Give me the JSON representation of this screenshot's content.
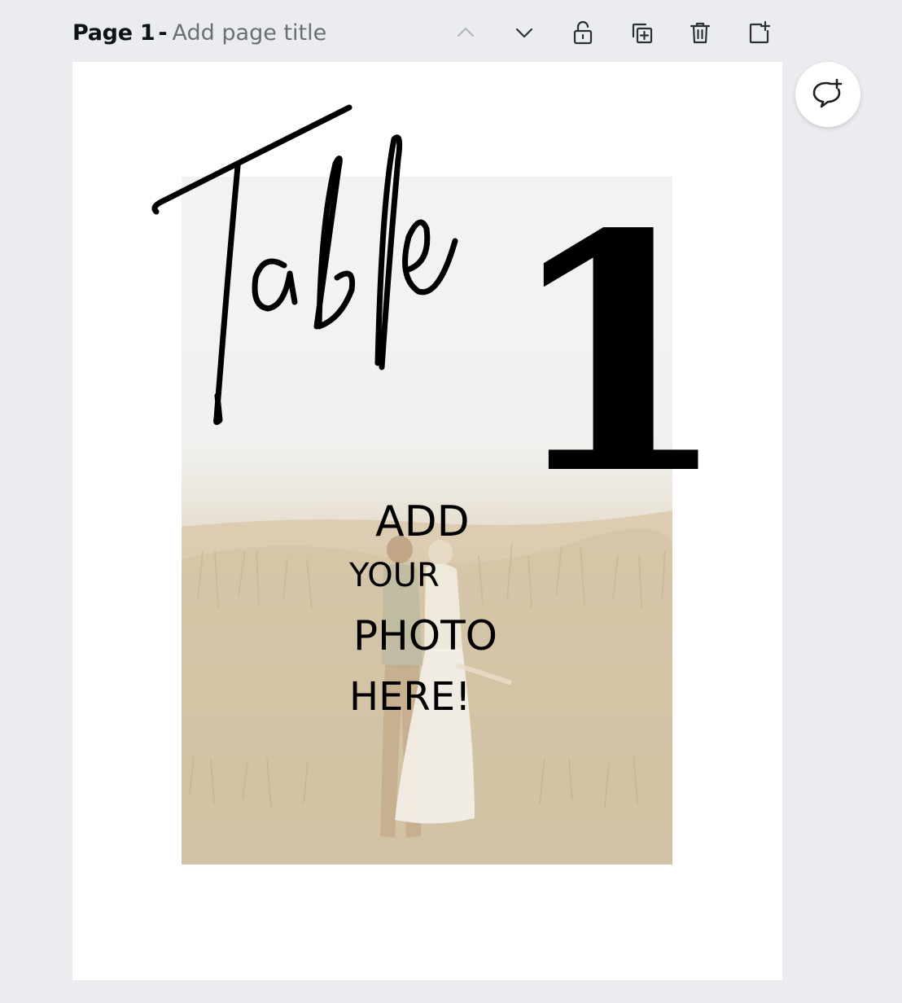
{
  "header": {
    "page_label": "Page 1",
    "separator": "-",
    "title_placeholder": "Add page title"
  },
  "toolbar": {
    "move_up": "chevron-up-icon",
    "move_down": "chevron-down-icon",
    "lock": "lock-icon",
    "duplicate": "duplicate-page-icon",
    "delete": "trash-icon",
    "add_page": "add-page-icon"
  },
  "canvas": {
    "script_title": "Table",
    "number": "1",
    "photo_prompt": {
      "line1": "ADD",
      "line2": "YOUR",
      "line3": "PHOTO",
      "line4": "HERE!"
    }
  },
  "comment": {
    "icon": "comment-add-icon"
  },
  "colors": {
    "background": "#ebecf0",
    "page": "#ffffff",
    "text_dark": "#0e1318",
    "text_muted": "#6b6f75"
  }
}
